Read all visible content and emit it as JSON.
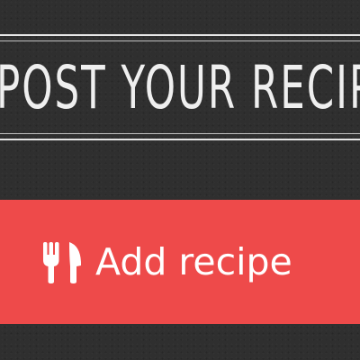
{
  "banner": {
    "title": "POST YOUR RECIPE"
  },
  "add_button": {
    "label": "Add recipe",
    "icon": "utensils-icon"
  },
  "colors": {
    "background": "#2f2f2f",
    "banner_text": "#efefef",
    "button_background": "#ee4a4a",
    "button_text": "#ffffff"
  }
}
